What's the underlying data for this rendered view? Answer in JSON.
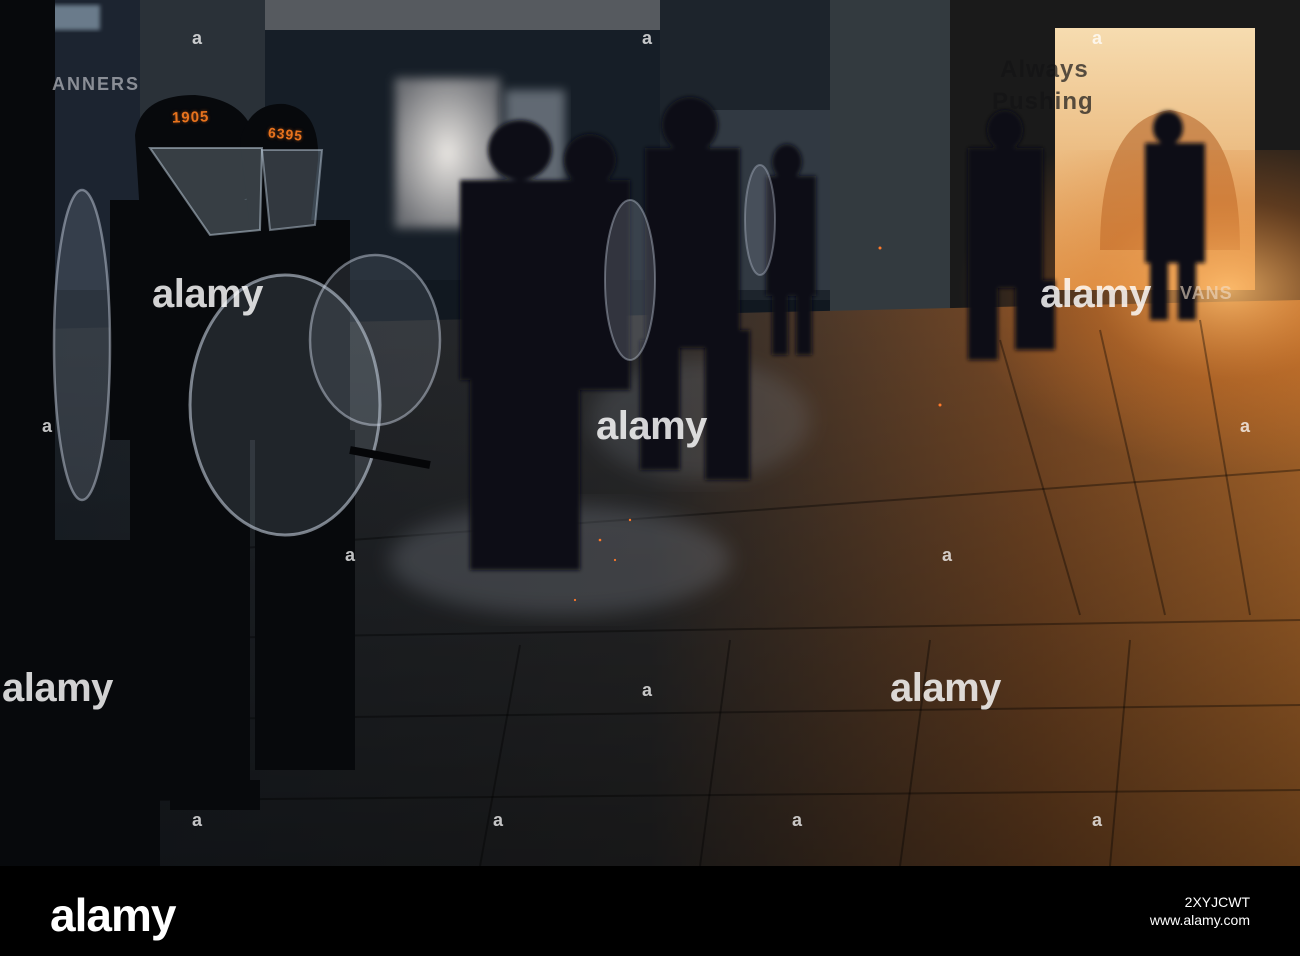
{
  "photo": {
    "alt_scene": "night street with police officers holding riot shields",
    "helmet_numbers": [
      "1905",
      "6395"
    ],
    "store_sign": "ANNERS",
    "billboard_text": [
      "Always",
      "Pushing",
      "VANS"
    ],
    "colors": {
      "street_glow": "#e8872e",
      "helmet_number": "#e8731d",
      "night": "#0d1218"
    }
  },
  "watermark": {
    "text": "alamy",
    "dot": "a"
  },
  "footer": {
    "logo": "alamy",
    "image_id": "2XYJCWT",
    "site": "www.alamy.com"
  }
}
